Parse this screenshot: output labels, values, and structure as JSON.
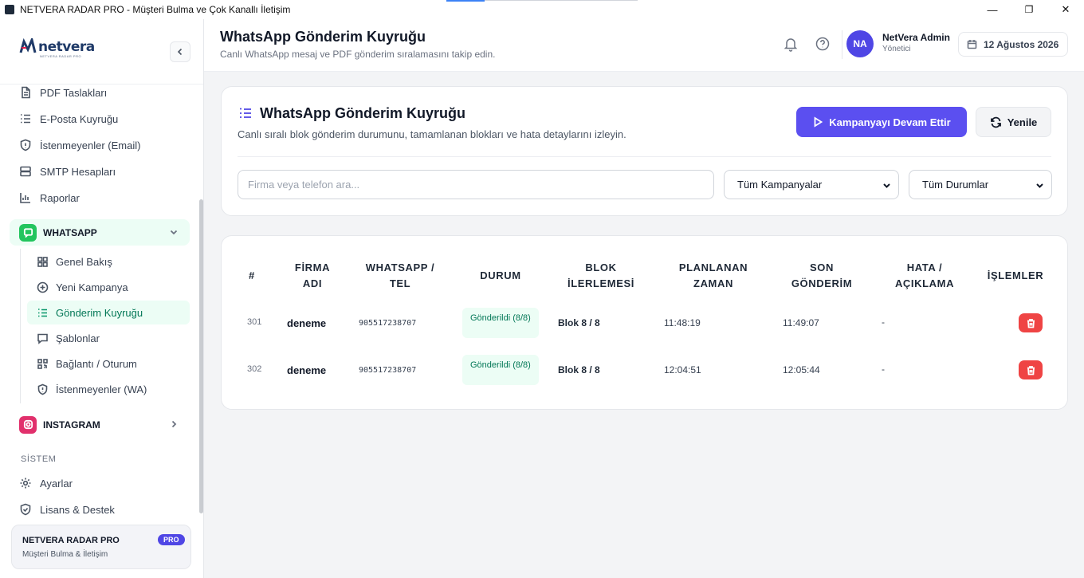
{
  "window": {
    "title": "NETVERA RADAR PRO - Müşteri Bulma ve Çok Kanallı İletişim",
    "minimize": "—",
    "maximize": "❐",
    "close": "✕"
  },
  "sidebar": {
    "logo_text": "netvera",
    "logo_tagline": "NETVERA RADAR PRO",
    "collapse_icon": "chevron-left-icon",
    "items": [
      {
        "label": "PDF Taslakları",
        "icon": "file-icon"
      },
      {
        "label": "E-Posta Kuyruğu",
        "icon": "list-icon"
      },
      {
        "label": "İstenmeyenler (Email)",
        "icon": "shield-icon"
      },
      {
        "label": "SMTP Hesapları",
        "icon": "server-icon"
      },
      {
        "label": "Raporlar",
        "icon": "chart-icon"
      }
    ],
    "whatsapp_group": {
      "label": "WHATSAPP",
      "color": "#22c55e",
      "subitems": [
        {
          "label": "Genel Bakış",
          "icon": "grid-icon"
        },
        {
          "label": "Yeni Kampanya",
          "icon": "plus-circle-icon"
        },
        {
          "label": "Gönderim Kuyruğu",
          "icon": "list-icon",
          "active": true
        },
        {
          "label": "Şablonlar",
          "icon": "message-icon"
        },
        {
          "label": "Bağlantı / Oturum",
          "icon": "qr-icon"
        },
        {
          "label": "İstenmeyenler (WA)",
          "icon": "shield-icon"
        }
      ]
    },
    "instagram_group": {
      "label": "INSTAGRAM",
      "color": "#e1306c"
    },
    "system_label": "SİSTEM",
    "system_items": [
      {
        "label": "Ayarlar",
        "icon": "gear-icon"
      },
      {
        "label": "Lisans & Destek",
        "icon": "shield-check-icon"
      }
    ],
    "pro_card": {
      "name": "NETVERA RADAR PRO",
      "badge": "PRO",
      "subtitle": "Müşteri Bulma & İletişim"
    }
  },
  "header": {
    "title": "WhatsApp Gönderim Kuyruğu",
    "subtitle": "Canlı WhatsApp mesaj ve PDF gönderim sıralamasını takip edin.",
    "user_initials": "NA",
    "user_name": "NetVera Admin",
    "user_role": "Yönetici",
    "date": "12 Ağustos 2026"
  },
  "queue_card": {
    "title": "WhatsApp Gönderim Kuyruğu",
    "subtitle": "Canlı sıralı blok gönderim durumunu, tamamlanan blokları ve hata detaylarını izleyin.",
    "resume_button": "Kampanyayı Devam Ettir",
    "refresh_button": "Yenile",
    "search_placeholder": "Firma veya telefon ara...",
    "campaign_filter": "Tüm Kampanyalar",
    "status_filter": "Tüm Durumlar",
    "accent_color": "#5b4ff0"
  },
  "table": {
    "columns": [
      "#",
      "FİRMA ADI",
      "WHATSAPP / TEL",
      "DURUM",
      "BLOK İLERLEMESİ",
      "PLANLANAN ZAMAN",
      "SON GÖNDERİM",
      "HATA / AÇIKLAMA",
      "İŞLEMLER"
    ],
    "rows": [
      {
        "id": "301",
        "firm": "deneme",
        "phone": "905517238707",
        "status": "Gönderildi (8/8)",
        "progress": "Blok 8 / 8",
        "planned": "11:48:19",
        "last_sent": "11:49:07",
        "error": "-"
      },
      {
        "id": "302",
        "firm": "deneme",
        "phone": "905517238707",
        "status": "Gönderildi (8/8)",
        "progress": "Blok 8 / 8",
        "planned": "12:04:51",
        "last_sent": "12:05:44",
        "error": "-"
      }
    ]
  }
}
